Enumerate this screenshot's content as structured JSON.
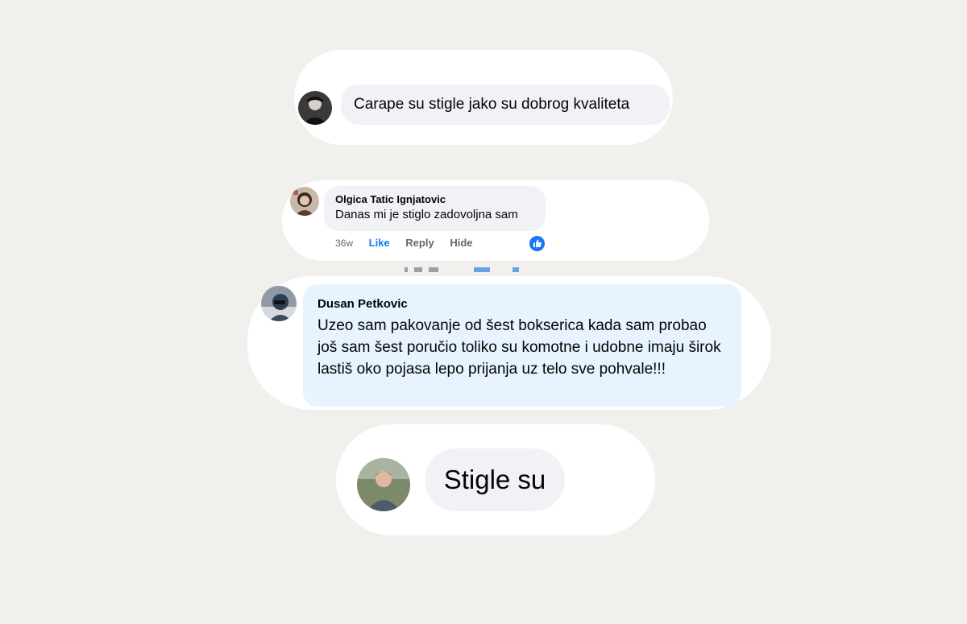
{
  "comments": [
    {
      "author": "",
      "text": "Carape su stigle jako su dobrog kvaliteta",
      "avatar_icon": "profile-photo-dark"
    },
    {
      "author": "Olgica Tatic Ignjatovic",
      "text": "Danas mi je stiglo zadovoljna sam",
      "avatar_icon": "profile-photo-woman",
      "time": "36w",
      "like_label": "Like",
      "reply_label": "Reply",
      "hide_label": "Hide",
      "reaction_icon": "thumbs-up-reaction-icon"
    },
    {
      "author": "Dusan Petkovic",
      "text": "Uzeo sam pakovanje od šest bokserica kada sam probao još sam šest poručio toliko su komotne i udobne imaju širok lastiš oko pojasa lepo prijanja uz telo sve pohvale!!!",
      "avatar_icon": "profile-photo-man"
    },
    {
      "author": "",
      "text": "Stigle su",
      "avatar_icon": "profile-photo-outdoor"
    }
  ],
  "colors": {
    "background": "#f2f0ec",
    "bubble": "#f0f2f5",
    "highlight_bubble": "#e7f3ff",
    "like_blue": "#1877f2"
  }
}
